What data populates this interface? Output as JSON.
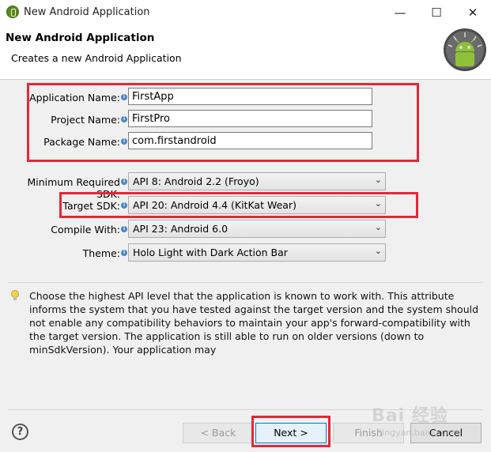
{
  "window": {
    "title": "New Android Application",
    "minimize": "—",
    "maximize": "☐",
    "close": "✕"
  },
  "header": {
    "title": "New Android Application",
    "subtitle": "Creates a new Android Application"
  },
  "form": {
    "application_name": {
      "label": "Application Name:",
      "value": "FirstApp"
    },
    "project_name": {
      "label": "Project Name:",
      "value": "FirstPro"
    },
    "package_name": {
      "label": "Package Name:",
      "value": "com.firstandroid"
    },
    "min_sdk": {
      "label": "Minimum Required SDK:",
      "value": "API 8: Android 2.2 (Froyo)"
    },
    "target_sdk": {
      "label": "Target SDK:",
      "value": "API 20: Android 4.4 (KitKat Wear)"
    },
    "compile_with": {
      "label": "Compile With:",
      "value": "API 23: Android 6.0"
    },
    "theme": {
      "label": "Theme:",
      "value": "Holo Light with Dark Action Bar"
    }
  },
  "hint": "Choose the highest API level that the application is known to work with. This attribute informs the system that you have tested against the target version and the system should not enable any compatibility behaviors to maintain your app's forward-compatibility with the target version. The application is still able to run on older versions (down to minSdkVersion). Your application may",
  "buttons": {
    "help": "?",
    "back": "< Back",
    "next": "Next >",
    "finish": "Finish",
    "cancel": "Cancel"
  },
  "watermark": {
    "main": "Bai 经验",
    "sub": "jingyan.baidu.com"
  },
  "colors": {
    "highlight": "#e0293a",
    "android_green": "#8ec03a"
  },
  "icons": {
    "app": "eclipse-android-icon",
    "logo": "android-logo-icon",
    "bulb": "lightbulb-icon",
    "combo": "chevron-down-icon"
  }
}
